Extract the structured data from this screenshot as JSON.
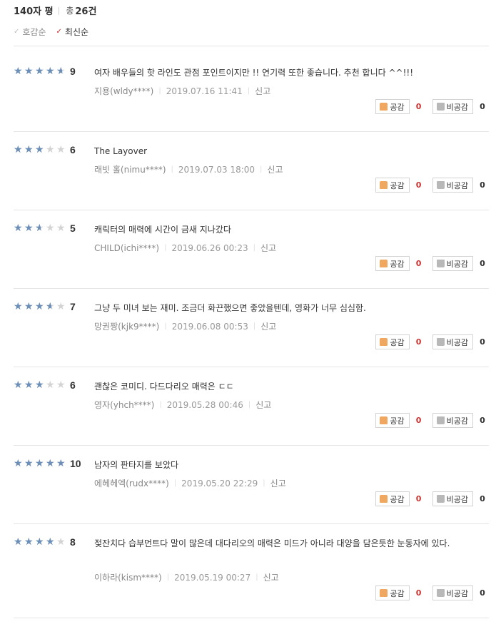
{
  "header": {
    "title": "140자 평",
    "total_label": "총",
    "total_count": "26건"
  },
  "sort": {
    "likes_label": "호감순",
    "latest_label": "최신순",
    "check": "✓"
  },
  "buttons": {
    "like_label": "공감",
    "dislike_label": "비공감",
    "report_label": "신고"
  },
  "colors": {
    "star_filled": "#6c8fb7",
    "star_empty": "#d3d3d3",
    "like_count": "#c8322f"
  },
  "reviews": [
    {
      "score": "9",
      "rating": 9,
      "text": "여자 배우들의 핫 라인도 관점 포인트이지만 !! 연기력 또한 좋습니다. 추천 합니다 ^^!!!",
      "author": "지용(wldy****)",
      "date": "2019.07.16 11:41",
      "likes": "0",
      "dislikes": "0"
    },
    {
      "score": "6",
      "rating": 6,
      "text": "The Layover",
      "author": "래빗 홀(nimu****)",
      "date": "2019.07.03 18:00",
      "likes": "0",
      "dislikes": "0"
    },
    {
      "score": "5",
      "rating": 5,
      "text": "캐릭터의 매력에 시간이 금새 지나갔다",
      "author": "CHILD(ichi****)",
      "date": "2019.06.26 00:23",
      "likes": "0",
      "dislikes": "0"
    },
    {
      "score": "7",
      "rating": 7,
      "text": "그냥 두 미녀 보는 재미. 조금더 화끈했으면 좋았을텐데, 영화가 너무 심심함.",
      "author": "망권짱(kjk9****)",
      "date": "2019.06.08 00:53",
      "likes": "0",
      "dislikes": "0"
    },
    {
      "score": "6",
      "rating": 6,
      "text": "괜찮은 코미디. 다드다리오 매력은 ㄷㄷ",
      "author": "영자(yhch****)",
      "date": "2019.05.28 00:46",
      "likes": "0",
      "dislikes": "0"
    },
    {
      "score": "10",
      "rating": 10,
      "text": "남자의 판타지를 보았다",
      "author": "에헤헤엑(rudx****)",
      "date": "2019.05.20 22:29",
      "likes": "0",
      "dislikes": "0"
    },
    {
      "score": "8",
      "rating": 8,
      "text": "젖잔치다 습부먼트다 말이 많은데 대다리오의 매력은 미드가 아니라 대양을 담은듯한 눈동자에 있다.",
      "author": "이하라(kism****)",
      "date": "2019.05.19 00:27",
      "likes": "0",
      "dislikes": "0"
    }
  ]
}
